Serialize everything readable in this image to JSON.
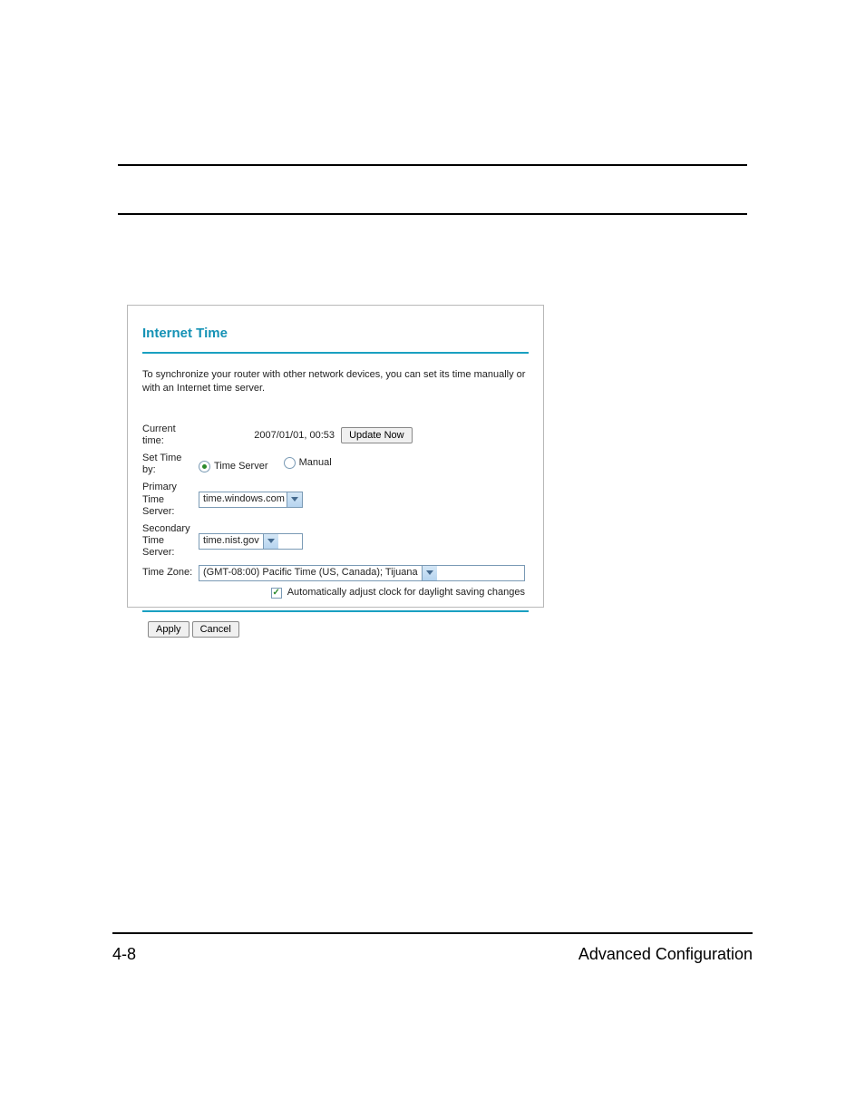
{
  "page": {
    "number": "4-8",
    "footer_title": "Advanced Configuration"
  },
  "panel": {
    "title": "Internet Time",
    "description": "To synchronize your router with other network devices, you can set its time manually or with an Internet time server.",
    "current_time_label": "Current time:",
    "current_time_value": "2007/01/01, 00:53",
    "update_now_label": "Update Now",
    "set_time_by_label": "Set Time by:",
    "radio_time_server": "Time Server",
    "radio_manual": "Manual",
    "primary_server_label": "Primary Time Server:",
    "primary_server_value": "time.windows.com",
    "secondary_server_label": "Secondary Time Server:",
    "secondary_server_value": "time.nist.gov",
    "time_zone_label": "Time Zone:",
    "time_zone_value": "(GMT-08:00) Pacific Time (US, Canada); Tijuana",
    "dst_label": "Automatically adjust clock for daylight saving changes",
    "apply_label": "Apply",
    "cancel_label": "Cancel"
  }
}
